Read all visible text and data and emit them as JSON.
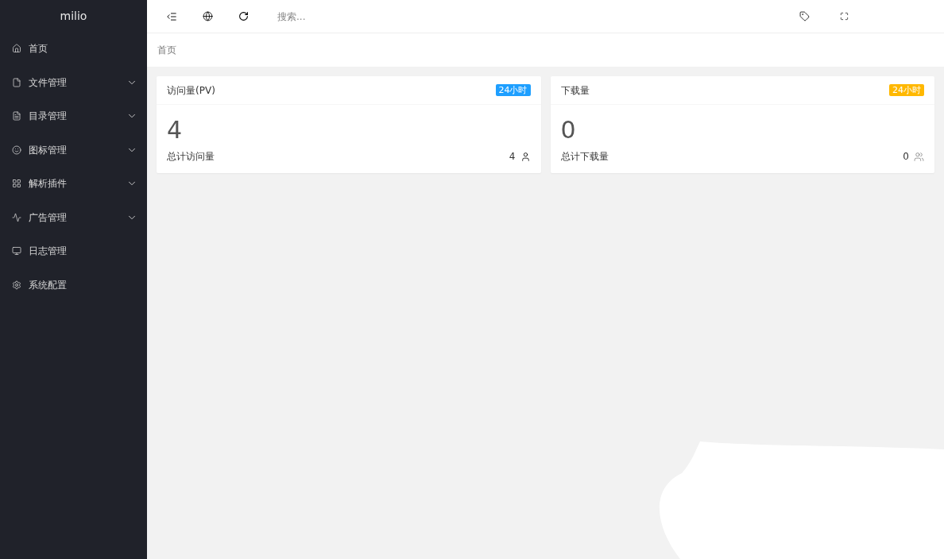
{
  "sidebar": {
    "logo": "milio",
    "items": [
      {
        "label": "首页",
        "expandable": false
      },
      {
        "label": "文件管理",
        "expandable": true
      },
      {
        "label": "目录管理",
        "expandable": true
      },
      {
        "label": "图标管理",
        "expandable": true
      },
      {
        "label": "解析插件",
        "expandable": true
      },
      {
        "label": "广告管理",
        "expandable": true
      },
      {
        "label": "日志管理",
        "expandable": false
      },
      {
        "label": "系统配置",
        "expandable": false
      }
    ]
  },
  "header": {
    "search": {
      "placeholder": "搜索..."
    }
  },
  "breadcrumb": "首页",
  "cards": [
    {
      "title": "访问量(PV)",
      "badge": "24小时",
      "color": "#1e9fff",
      "value": "4",
      "footer": "总计访问量",
      "count": "4"
    },
    {
      "title": "下载量",
      "badge": "24小时",
      "color": "#ffb800",
      "value": "0",
      "footer": "总计下载量",
      "count": "0"
    }
  ]
}
